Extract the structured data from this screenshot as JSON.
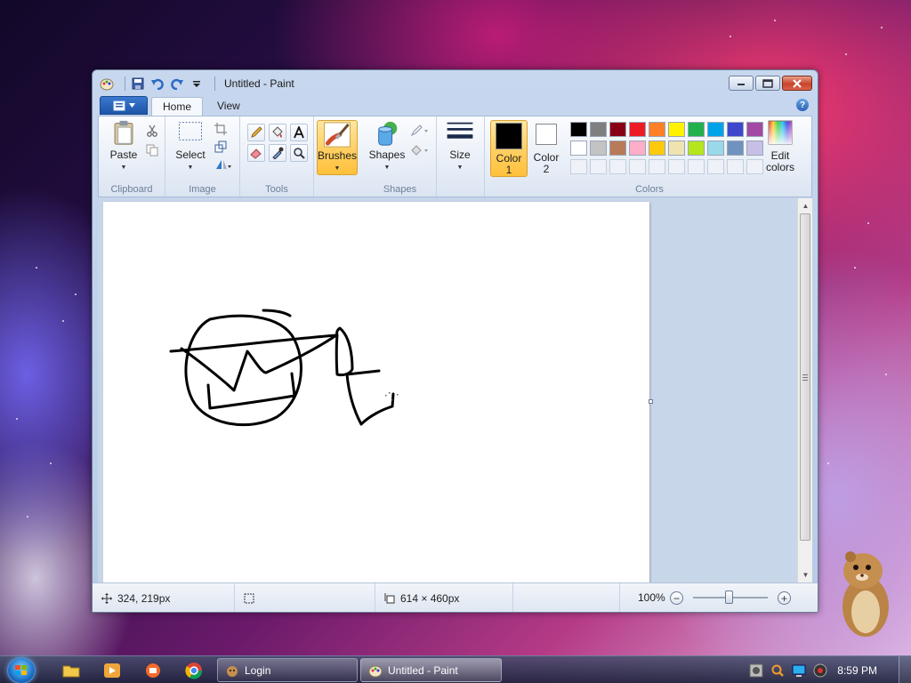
{
  "window": {
    "title": "Untitled - Paint",
    "minimize_icon": "minimize-icon",
    "maximize_icon": "maximize-icon",
    "close_icon": "close-icon"
  },
  "quick_access": [
    "paint-app-icon",
    "save-icon",
    "undo-icon",
    "redo-icon",
    "customize-chevron-icon"
  ],
  "tabs": [
    {
      "label": "Home",
      "active": true
    },
    {
      "label": "View",
      "active": false
    }
  ],
  "ribbon": {
    "clipboard": {
      "label": "Clipboard",
      "paste": "Paste"
    },
    "image": {
      "label": "Image",
      "select": "Select"
    },
    "tools": {
      "label": "Tools"
    },
    "brushes": {
      "label": "Brushes"
    },
    "shapes": {
      "label": "Shapes",
      "button": "Shapes"
    },
    "size": {
      "label": "Size"
    },
    "colors": {
      "label": "Colors",
      "color1": "Color 1",
      "color1_line1": "Color",
      "color1_line2": "1",
      "color2_line1": "Color",
      "color2_line2": "2",
      "edit_line1": "Edit",
      "edit_line2": "colors",
      "color1_value": "#000000",
      "color2_value": "#ffffff",
      "palette_row1": [
        "#000000",
        "#7f7f7f",
        "#880015",
        "#ed1c24",
        "#ff7f27",
        "#fff200",
        "#22b14c",
        "#00a2e8",
        "#3f48cc",
        "#a349a4"
      ],
      "palette_row2": [
        "#ffffff",
        "#c3c3c3",
        "#b97a57",
        "#ffaec9",
        "#ffc90e",
        "#efe4b0",
        "#b5e61d",
        "#99d9ea",
        "#7092be",
        "#c8bfe7"
      ]
    }
  },
  "status": {
    "cursor_pos": "324, 219px",
    "image_size": "614 × 460px",
    "zoom": "100%",
    "zoom_level": 0.5
  },
  "taskbar": {
    "tasks": [
      {
        "label": "Login",
        "active": false
      },
      {
        "label": "Untitled - Paint",
        "active": true
      }
    ],
    "clock": "8:59 PM"
  }
}
